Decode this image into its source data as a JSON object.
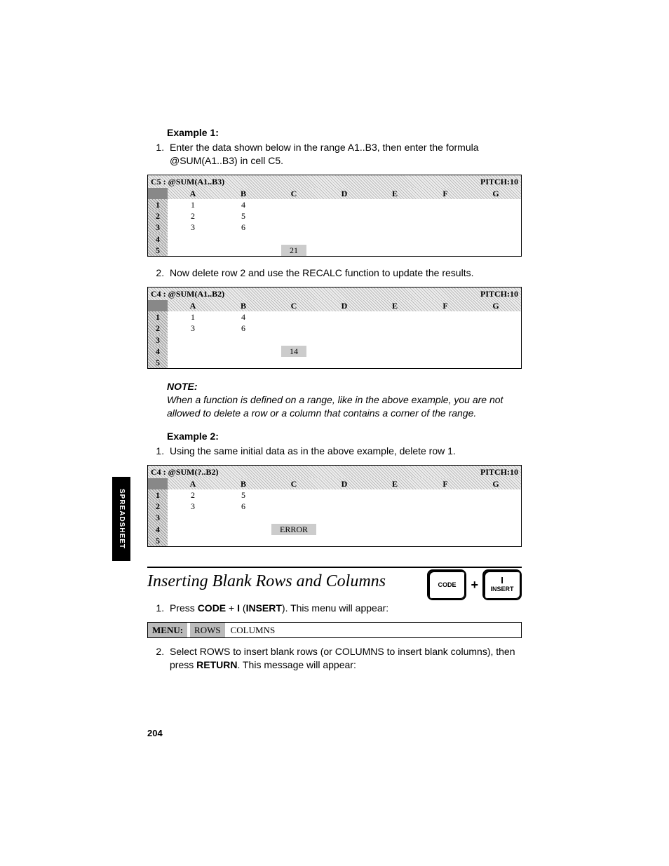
{
  "sideTab": "SPREADSHEET",
  "pageNumber": "204",
  "example1": {
    "heading": "Example 1:",
    "step1": "Enter the data shown below in the range A1..B3, then enter the formula @SUM(A1..B3) in cell C5.",
    "step2": "Now delete row 2 and use the RECALC function to update the results."
  },
  "sheet1": {
    "cellRef": "C5 : @SUM(A1..B3)",
    "pitch": "PITCH:10",
    "cols": [
      "A",
      "B",
      "C",
      "D",
      "E",
      "F",
      "G"
    ],
    "rowLabels": [
      "1",
      "2",
      "3",
      "4",
      "5"
    ],
    "data": {
      "r1a": "1",
      "r1b": "4",
      "r2a": "2",
      "r2b": "5",
      "r3a": "3",
      "r3b": "6",
      "r5c": "21"
    }
  },
  "sheet2": {
    "cellRef": "C4 : @SUM(A1..B2)",
    "pitch": "PITCH:10",
    "cols": [
      "A",
      "B",
      "C",
      "D",
      "E",
      "F",
      "G"
    ],
    "rowLabels": [
      "1",
      "2",
      "3",
      "4",
      "5"
    ],
    "data": {
      "r1a": "1",
      "r1b": "4",
      "r2a": "3",
      "r2b": "6",
      "r4c": "14"
    }
  },
  "note": {
    "heading": "NOTE:",
    "body": "When a function is defined on a range, like in the above example, you are not allowed to delete a row or a column that contains a corner of the range."
  },
  "example2": {
    "heading": "Example 2:",
    "step1": "Using the same initial data as in the above example, delete row 1."
  },
  "sheet3": {
    "cellRef": "C4 : @SUM(?..B2)",
    "pitch": "PITCH:10",
    "cols": [
      "A",
      "B",
      "C",
      "D",
      "E",
      "F",
      "G"
    ],
    "rowLabels": [
      "1",
      "2",
      "3",
      "4",
      "5"
    ],
    "data": {
      "r1a": "2",
      "r1b": "5",
      "r2a": "3",
      "r2b": "6",
      "r4c": "ERROR"
    }
  },
  "section": {
    "title": "Inserting Blank Rows and Columns",
    "keyCode": "CODE",
    "keyPlus": "+",
    "keyI": "I",
    "keyInsert": "INSERT",
    "step1_a": "Press ",
    "step1_b": "CODE",
    "step1_c": " + ",
    "step1_d": "I",
    "step1_e": " (",
    "step1_f": "INSERT",
    "step1_g": "). This menu will appear:",
    "menuLabel": "MENU:",
    "menuSel": "ROWS",
    "menuOpt": "COLUMNS",
    "step2_a": "Select ROWS to insert blank rows (or COLUMNS to insert blank columns), then press ",
    "step2_b": "RETURN",
    "step2_c": ". This message will appear:"
  }
}
